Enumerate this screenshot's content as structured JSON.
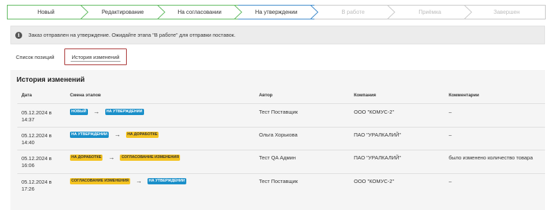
{
  "stepper": [
    {
      "label": "Новый",
      "state": "done"
    },
    {
      "label": "Редактирование",
      "state": "done"
    },
    {
      "label": "На согласовании",
      "state": "done"
    },
    {
      "label": "На утверждении",
      "state": "current"
    },
    {
      "label": "В работе",
      "state": "future"
    },
    {
      "label": "Приёмка",
      "state": "future"
    },
    {
      "label": "Завершен",
      "state": "future"
    }
  ],
  "notice": {
    "icon": "info-icon",
    "text": "Заказ отправлен на утверждение. Ожидайте этапа \"В работе\" для отправки поставок."
  },
  "tabs": {
    "positions": "Список позиций",
    "history": "История изменений"
  },
  "history": {
    "title": "История изменений",
    "columns": {
      "date": "Дата",
      "stage": "Смена этапов",
      "author": "Автор",
      "company": "Компания",
      "comment": "Комментарии"
    },
    "rows": [
      {
        "date_line1": "05.12.2024 в",
        "date_line2": "14:37",
        "from": "НОВЫЙ",
        "from_color": "#1a8fc9",
        "to": "НА УТВЕРЖДЕНИИ",
        "to_color": "#1a8fc9",
        "author": "Тест Поставщик",
        "company": "ООО \"КОМУС-2\"",
        "comment": "–"
      },
      {
        "date_line1": "05.12.2024 в",
        "date_line2": "14:40",
        "from": "НА УТВЕРЖДЕНИИ",
        "from_color": "#1a8fc9",
        "to": "НА ДОРАБОТКЕ",
        "to_color": "#f4c321",
        "author": "Ольга Хорькова",
        "company": "ПАО \"УРАЛКАЛИЙ\"",
        "comment": "–"
      },
      {
        "date_line1": "05.12.2024 в",
        "date_line2": "16:06",
        "from": "НА ДОРАБОТКЕ",
        "from_color": "#f4c321",
        "to": "СОГЛАСОВАНИЕ ИЗМЕНЕНИЯ",
        "to_color": "#f4c321",
        "author": "Тест QA Админ",
        "company": "ПАО \"УРАЛКАЛИЙ\"",
        "comment": "было изменено количество товара"
      },
      {
        "date_line1": "05.12.2024 в",
        "date_line2": "17:26",
        "from": "СОГЛАСОВАНИЕ ИЗМЕНЕНИЯ",
        "from_color": "#f4c321",
        "to": "НА УТВЕРЖДЕНИИ",
        "to_color": "#1a8fc9",
        "author": "Тест Поставщик",
        "company": "ООО \"КОМУС-2\"",
        "comment": "–"
      }
    ]
  }
}
